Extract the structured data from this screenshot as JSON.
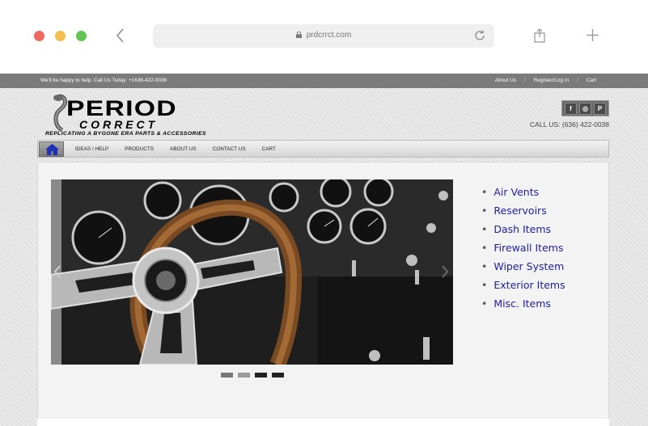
{
  "browser": {
    "url": "prdcrrct.com"
  },
  "topbar": {
    "message": "We'll be happy to help. Call Us Today: +1636-422-0038",
    "links": [
      "About Us",
      "Register/Log In",
      "Cart"
    ],
    "separator": "/"
  },
  "logo": {
    "title_line1": "PERIOD",
    "title_line2": "CORRECT",
    "tagline": "REPLICATING A BYGONE ERA    PARTS & ACCESSORIES"
  },
  "social": {
    "icons": [
      "facebook-icon",
      "instagram-icon",
      "pinterest-icon"
    ],
    "glyphs": [
      "f",
      "◎",
      "P"
    ]
  },
  "header": {
    "call_us": "CALL US: (636) 422-0038"
  },
  "nav": {
    "items": [
      "IDEAS / HELP",
      "PRODUCTS",
      "ABOUT US",
      "CONTACT US",
      "CART"
    ]
  },
  "slider": {
    "dots": [
      {
        "active": false,
        "color": "#777777"
      },
      {
        "active": false,
        "color": "#9a9a9a"
      },
      {
        "active": true,
        "color": "#222222"
      },
      {
        "active": true,
        "color": "#222222"
      }
    ]
  },
  "categories": {
    "items": [
      "Air Vents",
      "Reservoirs",
      "Dash Items",
      "Firewall Items",
      "Wiper System",
      "Exterior Items",
      "Misc. Items"
    ],
    "bullet": "•",
    "link_color": "#1e1e9e"
  }
}
